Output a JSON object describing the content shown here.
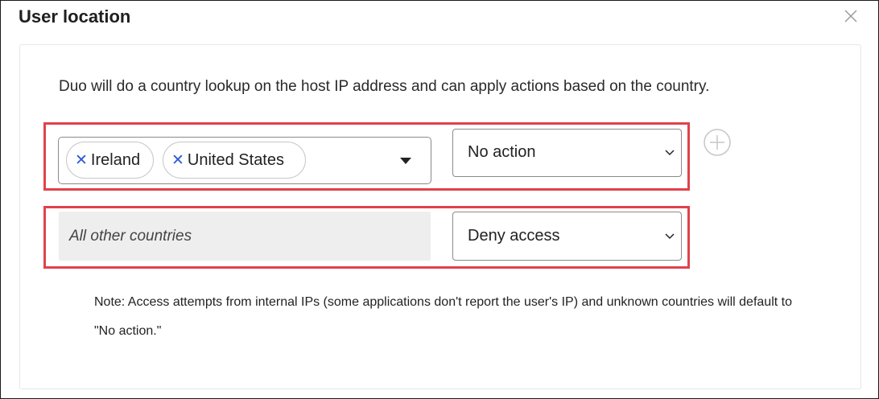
{
  "dialog": {
    "title": "User location",
    "close_icon": "close-icon"
  },
  "description": "Duo will do a country lookup on the host IP address and can apply actions based on the country.",
  "rule_1": {
    "countries": [
      {
        "remove_icon": "✕",
        "label": "Ireland"
      },
      {
        "remove_icon": "✕",
        "label": "United States"
      }
    ],
    "action": "No action"
  },
  "add_button_icon": "plus-circle-icon",
  "rule_other": {
    "label": "All other countries",
    "action": "Deny access"
  },
  "note": "Note: Access attempts from internal IPs (some applications don't report the user's IP) and unknown countries will default to \"No action.\"",
  "colors": {
    "highlight_border": "#e0424d",
    "chip_remove": "#2b59d9"
  }
}
